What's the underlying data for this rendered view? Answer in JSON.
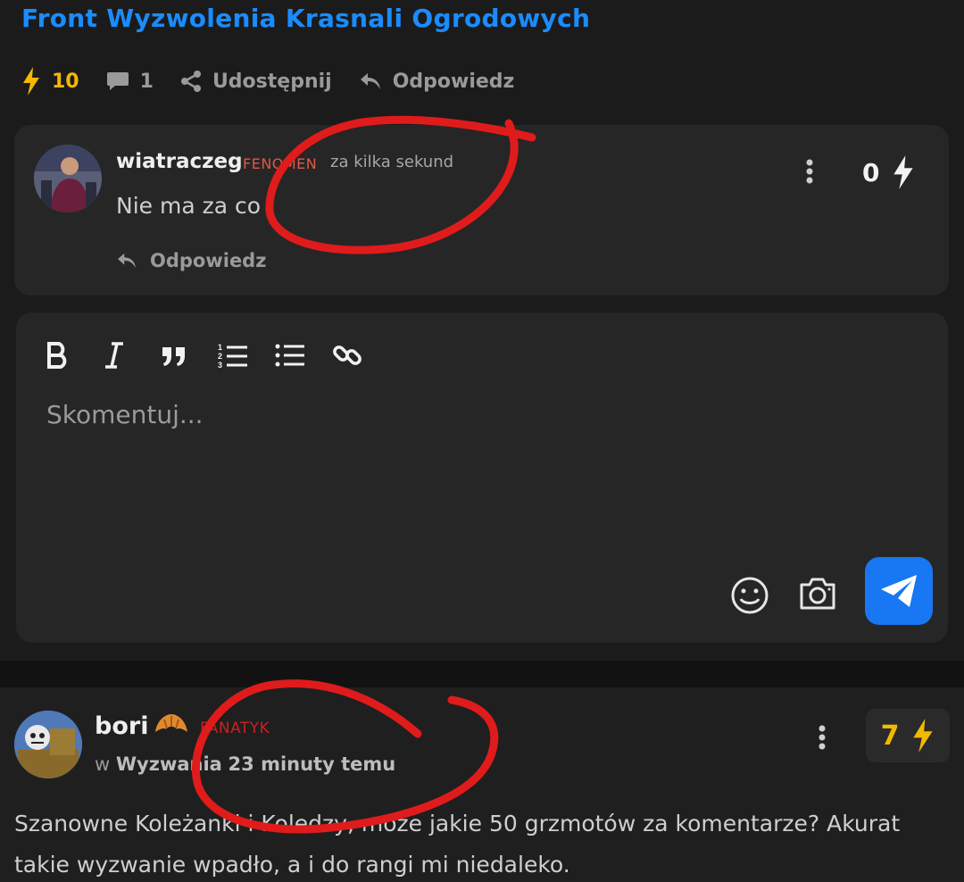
{
  "group_title": "Front Wyzwolenia Krasnali Ogrodowych",
  "actions": {
    "bolt_count": "10",
    "comment_count": "1",
    "share_label": "Udostępnij",
    "reply_label": "Odpowiedz"
  },
  "comment": {
    "username": "wiatraczeg",
    "rank": "FENOMEN",
    "time": "za kilka sekund",
    "text": "Nie ma za co",
    "reply_label": "Odpowiedz",
    "score": "0"
  },
  "editor": {
    "placeholder": "Skomentuj..."
  },
  "post": {
    "username": "bori",
    "rank": "FANATYK",
    "meta_prefix": "w",
    "group": "Wyzwania",
    "time": "23 minuty temu",
    "score": "7",
    "text": "Szanowne Koleżanki i Koledzy, może jakie 50 grzmotów za komentarze? Akurat takie wyzwanie wpadło, a i do rangi mi niedaleko."
  },
  "colors": {
    "accent_blue": "#1877f2",
    "title_blue": "#1a8cff",
    "bolt_yellow": "#f5b800",
    "rank_red": "#e0574a",
    "annotation_red": "#e01b1b"
  },
  "icons": [
    "bolt-icon",
    "comment-icon",
    "share-icon",
    "reply-icon",
    "more-vertical-icon",
    "bold-icon",
    "italic-icon",
    "quote-icon",
    "ordered-list-icon",
    "bullet-list-icon",
    "link-icon",
    "emoji-icon",
    "camera-icon",
    "send-icon",
    "croissant-icon"
  ]
}
